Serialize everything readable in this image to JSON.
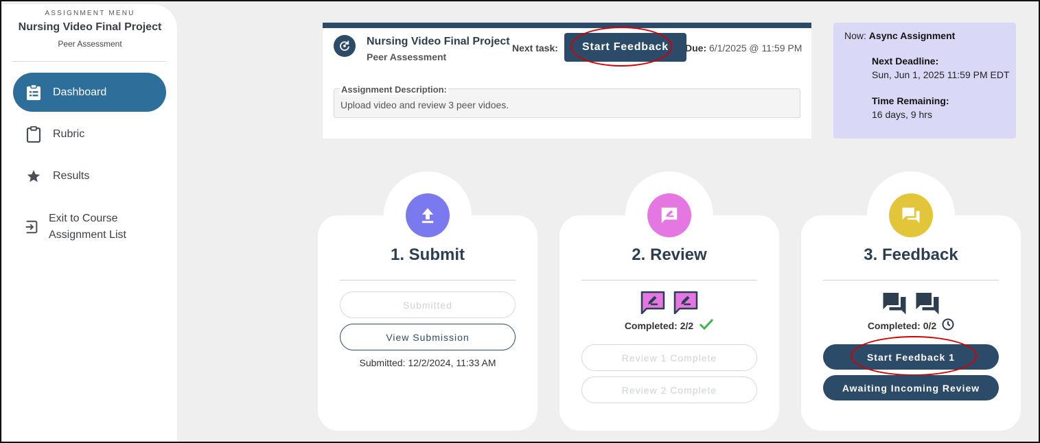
{
  "sidebar": {
    "caption": "ASSIGNMENT MENU",
    "title": "Nursing Video Final Project",
    "subtitle": "Peer Assessment",
    "items": [
      {
        "label": "Dashboard",
        "icon": "clipboard-list-icon",
        "active": true
      },
      {
        "label": "Rubric",
        "icon": "clipboard-icon",
        "active": false
      },
      {
        "label": "Results",
        "icon": "star-icon",
        "active": false
      },
      {
        "label": "Exit to Course Assignment List",
        "icon": "exit-icon",
        "active": false
      }
    ]
  },
  "assignment": {
    "title": "Nursing Video Final Project",
    "subtitle": "Peer Assessment",
    "next_task_label": "Next task:",
    "next_task_button": "Start Feedback",
    "due_label": "Due:",
    "due_value": "6/1/2025 @ 11:59 PM",
    "description_label": "Assignment Description:",
    "description_text": "Upload video and review 3 peer vidoes."
  },
  "status": {
    "now_label": "Now:",
    "now_value": "Async Assignment",
    "deadline_label": "Next Deadline:",
    "deadline_value": "Sun, Jun 1, 2025 11:59 PM EDT",
    "remaining_label": "Time Remaining:",
    "remaining_value": "16 days, 9 hrs"
  },
  "steps": {
    "submit": {
      "title": "1. Submit",
      "icon": "upload-icon",
      "color": "#7b79ee",
      "submitted_button": "Submitted",
      "view_button": "View Submission",
      "timestamp": "Submitted: 12/2/2024, 11:33 AM"
    },
    "review": {
      "title": "2. Review",
      "icon": "review-edit-icon",
      "color": "#e577e3",
      "completed": "Completed: 2/2",
      "review1": "Review 1 Complete",
      "review2": "Review 2 Complete"
    },
    "feedback": {
      "title": "3. Feedback",
      "icon": "chat-bubbles-icon",
      "color": "#e3c53a",
      "completed": "Completed: 0/2",
      "start_button": "Start Feedback 1",
      "awaiting_button": "Awaiting Incoming Review"
    }
  }
}
